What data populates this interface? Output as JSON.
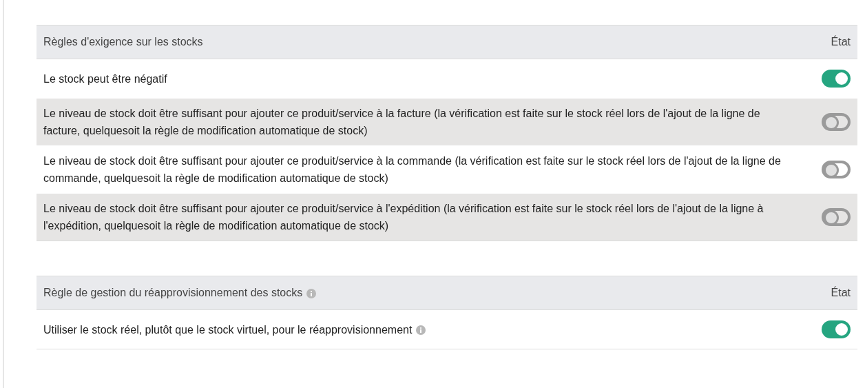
{
  "tables": [
    {
      "title": "Règles d'exigence sur les stocks",
      "title_info": false,
      "state_header": "État",
      "rows": [
        {
          "label": "Le stock peut être négatif",
          "info": false,
          "on": true
        },
        {
          "label": "Le niveau de stock doit être suffisant pour ajouter ce produit/service à la facture (la vérification est faite sur le stock réel lors de l'ajout de la ligne de facture, quelquesoit la règle de modification automatique de stock)",
          "info": false,
          "on": false
        },
        {
          "label": "Le niveau de stock doit être suffisant pour ajouter ce produit/service à la commande (la vérification est faite sur le stock réel lors de l'ajout de la ligne de commande, quelquesoit la règle de modification automatique de stock)",
          "info": false,
          "on": false
        },
        {
          "label": "Le niveau de stock doit être suffisant pour ajouter ce produit/service à l'expédition (la vérification est faite sur le stock réel lors de l'ajout de la ligne à l'expédition, quelquesoit la règle de modification automatique de stock)",
          "info": false,
          "on": false
        }
      ]
    },
    {
      "title": "Règle de gestion du réapprovisionnement des stocks",
      "title_info": true,
      "state_header": "État",
      "rows": [
        {
          "label": "Utiliser le stock réel, plutôt que le stock virtuel, pour le réapprovisionnement",
          "info": true,
          "on": true
        }
      ]
    }
  ]
}
